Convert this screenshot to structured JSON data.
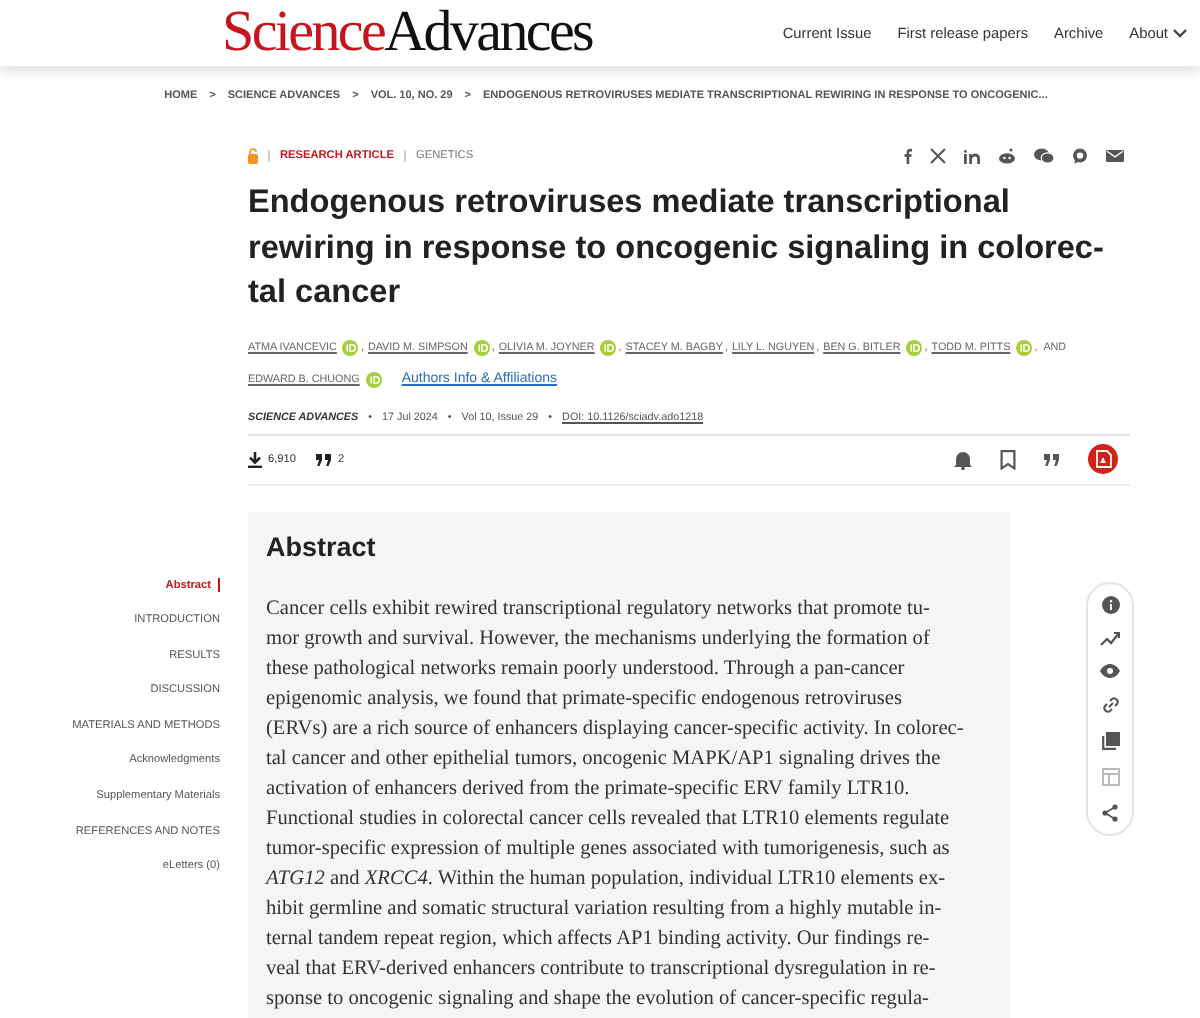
{
  "header": {
    "logo": {
      "first": "Science",
      "second": "Advances"
    },
    "nav": [
      {
        "label": "Current Issue",
        "kind": "link"
      },
      {
        "label": "First release papers",
        "kind": "link"
      },
      {
        "label": "Archive",
        "kind": "link"
      },
      {
        "label": "About",
        "kind": "menu"
      }
    ]
  },
  "breadcrumb": {
    "separator": ">",
    "items": [
      "HOME",
      "SCIENCE ADVANCES",
      "VOL. 10, NO. 29",
      "ENDOGENOUS RETROVIRUSES MEDIATE TRANSCRIPTIONAL REWIRING IN RESPONSE TO ONCOGENIC..."
    ]
  },
  "article": {
    "open_access": true,
    "type": "RESEARCH ARTICLE",
    "subject": "GENETICS",
    "title_lines": [
      "Endogenous retroviruses mediate transcriptional",
      "rewiring in response to oncogenic signaling in colorec-",
      "tal cancer"
    ],
    "authors": [
      {
        "name": "ATMA IVANCEVIC",
        "orcid": true
      },
      {
        "name": "DAVID M. SIMPSON",
        "orcid": true
      },
      {
        "name": "OLIVIA M. JOYNER",
        "orcid": true
      },
      {
        "name": "STACEY M. BAGBY",
        "orcid": false
      },
      {
        "name": "LILY L. NGUYEN",
        "orcid": false
      },
      {
        "name": "BEN G. BITLER",
        "orcid": true
      },
      {
        "name": "TODD M. PITTS",
        "orcid": true
      },
      {
        "name": "EDWARD B. CHUONG",
        "orcid": true
      }
    ],
    "author_separator": ",",
    "author_conjunction": "AND",
    "affiliations_link": "Authors Info & Affiliations",
    "meta": {
      "journal": "SCIENCE ADVANCES",
      "separator": "•",
      "date": "17 Jul 2024",
      "issue": "Vol 10, Issue 29",
      "doi": "DOI: 10.1126/sciadv.ado1218"
    },
    "metrics": {
      "downloads": "6,910",
      "citations": "2"
    }
  },
  "toc": [
    {
      "label": "Abstract",
      "selected": true
    },
    {
      "label": "INTRODUCTION",
      "selected": false
    },
    {
      "label": "RESULTS",
      "selected": false
    },
    {
      "label": "DISCUSSION",
      "selected": false
    },
    {
      "label": "MATERIALS AND METHODS",
      "selected": false
    },
    {
      "label": "Acknowledgments",
      "selected": false
    },
    {
      "label": "Supplementary Materials",
      "selected": false
    },
    {
      "label": "REFERENCES AND NOTES",
      "selected": false
    },
    {
      "label": "eLetters (0)",
      "selected": false
    }
  ],
  "abstract": {
    "heading": "Abstract",
    "lines": [
      "Cancer cells exhibit rewired transcriptional regulatory networks that promote tu-",
      "mor growth and survival. However, the mechanisms underlying the formation of",
      "these pathological networks remain poorly understood. Through a pan-cancer",
      "epigenomic analysis, we found that primate-specific endogenous retroviruses",
      "(ERVs) are a rich source of enhancers displaying cancer-specific activity. In colorec-",
      "tal cancer and other epithelial tumors, oncogenic MAPK/AP1 signaling drives the",
      "activation of enhancers derived from the primate-specific ERV family LTR10.",
      "Functional studies in colorectal cancer cells revealed that LTR10 elements regulate",
      "tumor-specific expression of multiple genes associated with tumorigenesis, such as",
      "*ATG12* and *XRCC4*. Within the human population, individual LTR10 elements ex-",
      "hibit germline and somatic structural variation resulting from a highly mutable in-",
      "ternal tandem repeat region, which affects AP1 binding activity. Our findings re-",
      "veal that ERV-derived enhancers contribute to transcriptional dysregulation in re-",
      "sponse to oncogenic signaling and shape the evolution of cancer-specific regula-"
    ]
  }
}
